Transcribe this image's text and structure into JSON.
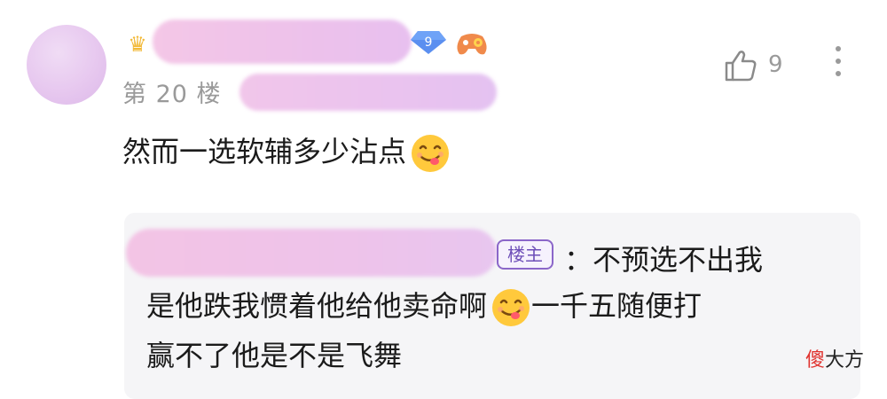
{
  "post": {
    "floor": "第 20 楼",
    "content": "然而一选软辅多少沾点",
    "level": "9",
    "likes": "9"
  },
  "reply": {
    "owner_badge": "楼主",
    "line1": "：不预选不出我",
    "line2": "是他跌我惯着他给他卖命啊",
    "line2b": "一千五随便打",
    "line3": "赢不了他是不是飞舞"
  },
  "watermark": {
    "part1": "傻",
    "part2": "大方"
  },
  "icons": {
    "like": "thumbs-up-icon",
    "more": "more-vertical-icon",
    "crown": "crown-icon",
    "level": "diamond-level-icon",
    "game": "gamepad-icon",
    "emoji": "yum-face-emoji"
  },
  "colors": {
    "blur_pink": "#eec3ea",
    "badge_purple": "#8b66c9",
    "reply_bg": "#f5f5f7",
    "meta_gray": "#9a9a9a",
    "watermark_red": "#e0332f"
  }
}
